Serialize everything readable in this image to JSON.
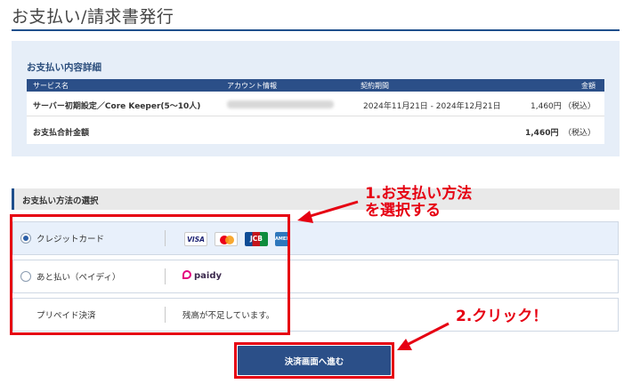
{
  "page": {
    "title": "お支払い/請求書発行"
  },
  "details": {
    "heading": "お支払い内容詳細",
    "columns": [
      "サービス名",
      "アカウント情報",
      "契約期間",
      "金額"
    ],
    "row": {
      "service": "サーバー初期設定／Core Keeper(5〜10人)",
      "account": "",
      "period": "2024年11月21日 - 2024年12月21日",
      "amount": "1,460円",
      "tax": "（税込）"
    },
    "total": {
      "label": "お支払合計金額",
      "amount": "1,460円",
      "tax": "（税込）"
    }
  },
  "methods": {
    "heading": "お支払い方法の選択",
    "options": [
      {
        "label": "クレジットカード",
        "selected": true,
        "cards": [
          "VISA",
          "MC",
          "JCB",
          "AMEX"
        ]
      },
      {
        "label": "あと払い（ペイディ）",
        "selected": false,
        "brand": "paidy"
      },
      {
        "label": "プリペイド決済",
        "note": "残高が不足しています。"
      }
    ]
  },
  "button": {
    "label": "決済画面へ進む"
  },
  "annotations": {
    "step1_line1": "1.お支払い方法",
    "step1_line2": "を選択する",
    "step2": "2.クリック！"
  },
  "colors": {
    "brand": "#2b4f88",
    "highlight": "#e60012"
  }
}
